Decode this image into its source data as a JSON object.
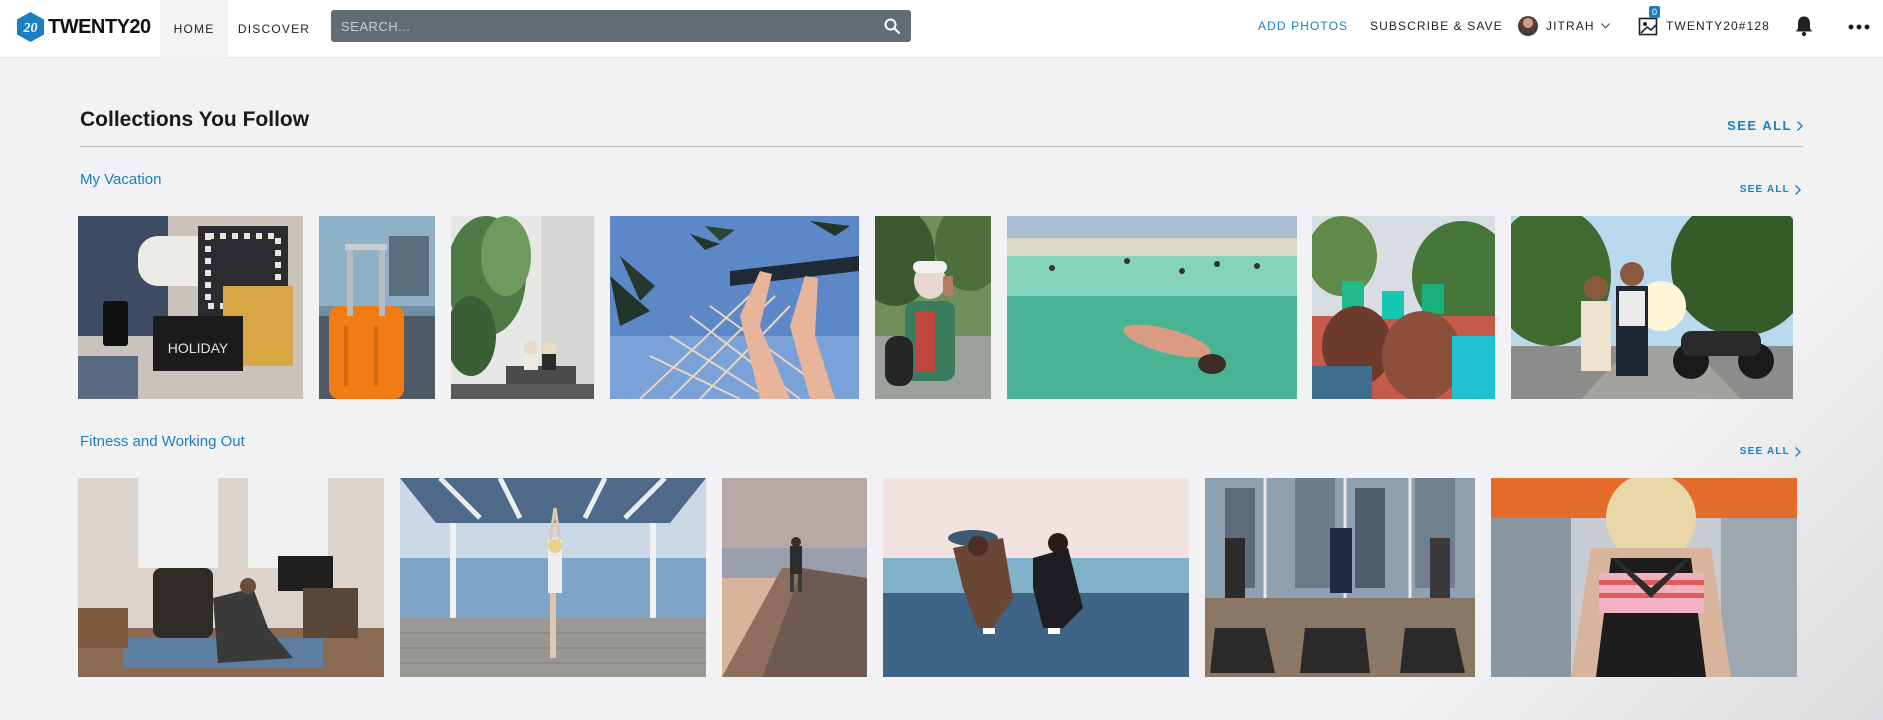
{
  "header": {
    "logo_text": "TWENTY20",
    "logo_badge": "20",
    "nav": {
      "home": "HOME",
      "discover": "DISCOVER"
    },
    "search_placeholder": "SEARCH...",
    "add_photos": "ADD PHOTOS",
    "subscribe": "SUBSCRIBE & SAVE",
    "username": "JITRAH",
    "board_count": "0",
    "board_name": "TWENTY20#128"
  },
  "main": {
    "section_title": "Collections You Follow",
    "see_all": "SEE ALL",
    "collections": [
      {
        "name": "My Vacation",
        "see_all": "SEE ALL",
        "photos": [
          "holiday-flatlay",
          "orange-suitcase",
          "plants-courtyard",
          "hammock-palms",
          "selfie-palms",
          "beach-float",
          "drinks-toast",
          "scooter-couple"
        ]
      },
      {
        "name": "Fitness and Working Out",
        "see_all": "SEE ALL",
        "photos": [
          "home-lunge",
          "yoga-pier",
          "pier-runner",
          "beach-workout",
          "treadmills",
          "gym-back"
        ]
      }
    ]
  },
  "colors": {
    "accent": "#1b7fc4",
    "search_bg": "#636b75",
    "page_bg": "#f2f2f4"
  }
}
